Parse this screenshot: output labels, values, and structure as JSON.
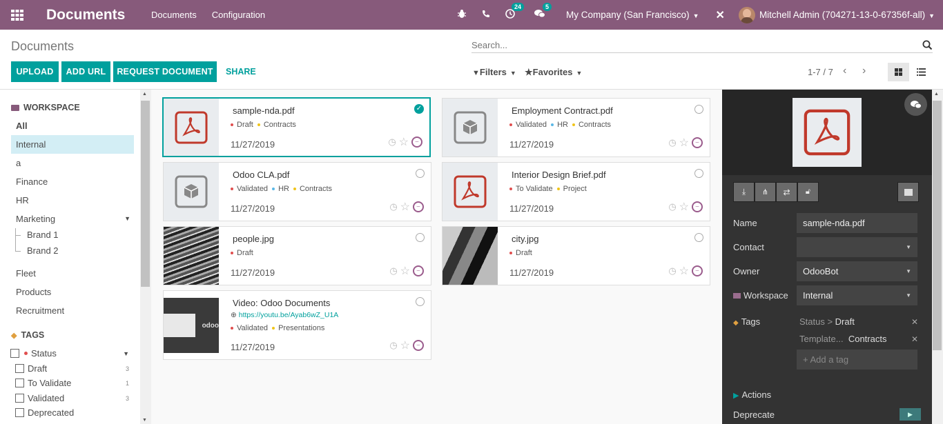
{
  "topbar": {
    "app_title": "Documents",
    "menu": [
      "Documents",
      "Configuration"
    ],
    "activity_count": "24",
    "message_count": "5",
    "company": "My Company (San Francisco)",
    "user": "Mitchell Admin (704271-13-0-67356f-all)"
  },
  "control_panel": {
    "breadcrumb": "Documents",
    "search_placeholder": "Search...",
    "buttons": {
      "upload": "UPLOAD",
      "add_url": "ADD URL",
      "request": "REQUEST DOCUMENT",
      "share": "SHARE"
    },
    "filters": "Filters",
    "favorites": "Favorites",
    "pager": "1-7 / 7"
  },
  "sidebar": {
    "workspace_title": "WORKSPACE",
    "workspaces": [
      "All",
      "Internal",
      "a",
      "Finance",
      "HR",
      "Marketing",
      "Brand 1",
      "Brand 2",
      "Fleet",
      "Products",
      "Recruitment"
    ],
    "tags_title": "TAGS",
    "status_label": "Status",
    "tags": [
      {
        "name": "Draft",
        "count": "3"
      },
      {
        "name": "To Validate",
        "count": "1"
      },
      {
        "name": "Validated",
        "count": "3"
      },
      {
        "name": "Deprecated",
        "count": ""
      }
    ]
  },
  "documents": [
    {
      "name": "sample-nda.pdf",
      "tags": [
        "Draft",
        "Contracts"
      ],
      "tag_colors": [
        "#e04f4f",
        "#f0c419"
      ],
      "date": "11/27/2019",
      "kind": "pdf",
      "selected": true
    },
    {
      "name": "Employment Contract.pdf",
      "tags": [
        "Validated",
        "HR",
        "Contracts"
      ],
      "tag_colors": [
        "#e04f4f",
        "#5bb8e6",
        "#f0c419"
      ],
      "date": "11/27/2019",
      "kind": "box"
    },
    {
      "name": "Odoo CLA.pdf",
      "tags": [
        "Validated",
        "HR",
        "Contracts"
      ],
      "tag_colors": [
        "#e04f4f",
        "#5bb8e6",
        "#f0c419"
      ],
      "date": "11/27/2019",
      "kind": "box"
    },
    {
      "name": "Interior Design Brief.pdf",
      "tags": [
        "To Validate",
        "Project"
      ],
      "tag_colors": [
        "#e04f4f",
        "#f0c419"
      ],
      "date": "11/27/2019",
      "kind": "pdf"
    },
    {
      "name": "people.jpg",
      "tags": [
        "Draft"
      ],
      "tag_colors": [
        "#e04f4f"
      ],
      "date": "11/27/2019",
      "kind": "photo-people"
    },
    {
      "name": "city.jpg",
      "tags": [
        "Draft"
      ],
      "tag_colors": [
        "#e04f4f"
      ],
      "date": "11/27/2019",
      "kind": "photo-city"
    },
    {
      "name": "Video: Odoo Documents",
      "url": "https://youtu.be/Ayab6wZ_U1A",
      "tags": [
        "Validated",
        "Presentations"
      ],
      "tag_colors": [
        "#e04f4f",
        "#f0c419"
      ],
      "date": "11/27/2019",
      "kind": "video"
    }
  ],
  "panel": {
    "labels": {
      "name": "Name",
      "contact": "Contact",
      "owner": "Owner",
      "workspace": "Workspace",
      "tags": "Tags",
      "actions": "Actions",
      "deprecate": "Deprecate"
    },
    "values": {
      "name": "sample-nda.pdf",
      "contact": "",
      "owner": "OdooBot",
      "workspace": "Internal"
    },
    "tag1_category": "Status > ",
    "tag1_value": "Draft",
    "tag2_category": "Template...",
    "tag2_value": "Contracts",
    "add_tag_placeholder": "+ Add a tag"
  },
  "colors": {
    "brand": "#875a7b",
    "accent": "#00a09d",
    "pdf_red": "#c0392b"
  }
}
